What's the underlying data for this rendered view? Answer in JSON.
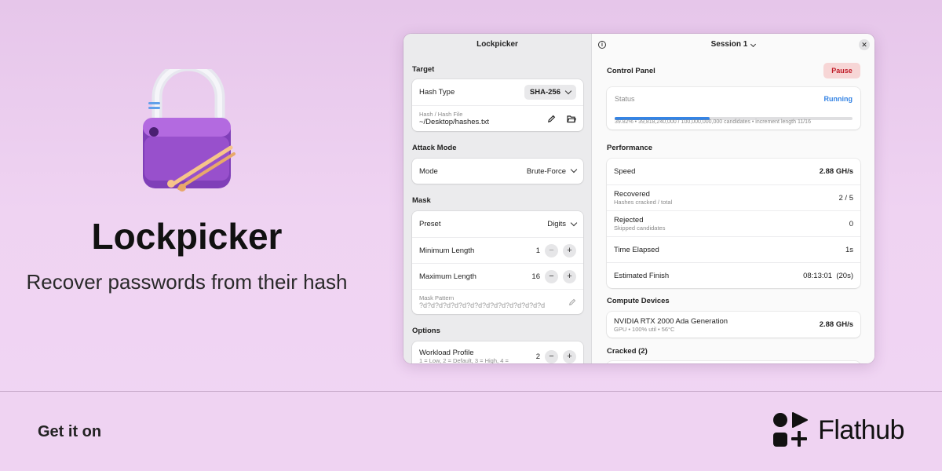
{
  "hero": {
    "app_name": "Lockpicker",
    "tagline": "Recover passwords from their hash"
  },
  "footer": {
    "get_it_on": "Get it on",
    "store_name": "Flathub"
  },
  "window": {
    "sidebar_title": "Lockpicker",
    "session_label": "Session 1",
    "close_glyph": "✕",
    "info_glyph": "i",
    "target": {
      "section": "Target",
      "hash_type_label": "Hash Type",
      "hash_type_value": "SHA-256",
      "hash_file_caption": "Hash / Hash File",
      "hash_file_value": "~/Desktop/hashes.txt"
    },
    "attack": {
      "section": "Attack Mode",
      "mode_label": "Mode",
      "mode_value": "Brute-Force"
    },
    "mask": {
      "section": "Mask",
      "preset_label": "Preset",
      "preset_value": "Digits",
      "min_label": "Minimum Length",
      "min_value": "1",
      "max_label": "Maximum Length",
      "max_value": "16",
      "pattern_caption": "Mask Pattern",
      "pattern_placeholder": "?d?d?d?d?d?d?d?d?d?d?d?d?d?d?d?d"
    },
    "options": {
      "section": "Options",
      "workload_label": "Workload Profile",
      "workload_sub": "1 = Low, 2 = Default, 3 = High, 4 =",
      "workload_value": "2"
    },
    "control": {
      "section": "Control Panel",
      "pause_label": "Pause",
      "status_label": "Status",
      "status_value": "Running",
      "progress_fraction": 0.3982,
      "progress_text": "39.82%  •  39,818,240,000 / 100,000,000,000 candidates  •  increment length 11/16",
      "status_color": "#3584e4"
    },
    "performance": {
      "section": "Performance",
      "speed_label": "Speed",
      "speed_value": "2.88 GH/s",
      "recovered_label": "Recovered",
      "recovered_sub": "Hashes cracked / total",
      "recovered_value": "2 / 5",
      "rejected_label": "Rejected",
      "rejected_sub": "Skipped candidates",
      "rejected_value": "0",
      "elapsed_label": "Time Elapsed",
      "elapsed_value": "1s",
      "finish_label": "Estimated Finish",
      "finish_value": "08:13:01  (20s)"
    },
    "devices": {
      "section": "Compute Devices",
      "device_name": "NVIDIA RTX 2000 Ada Generation",
      "device_sub": "GPU • 100% util • 56°C",
      "device_speed": "2.88 GH/s"
    },
    "cracked": {
      "section": "Cracked (2)"
    }
  }
}
